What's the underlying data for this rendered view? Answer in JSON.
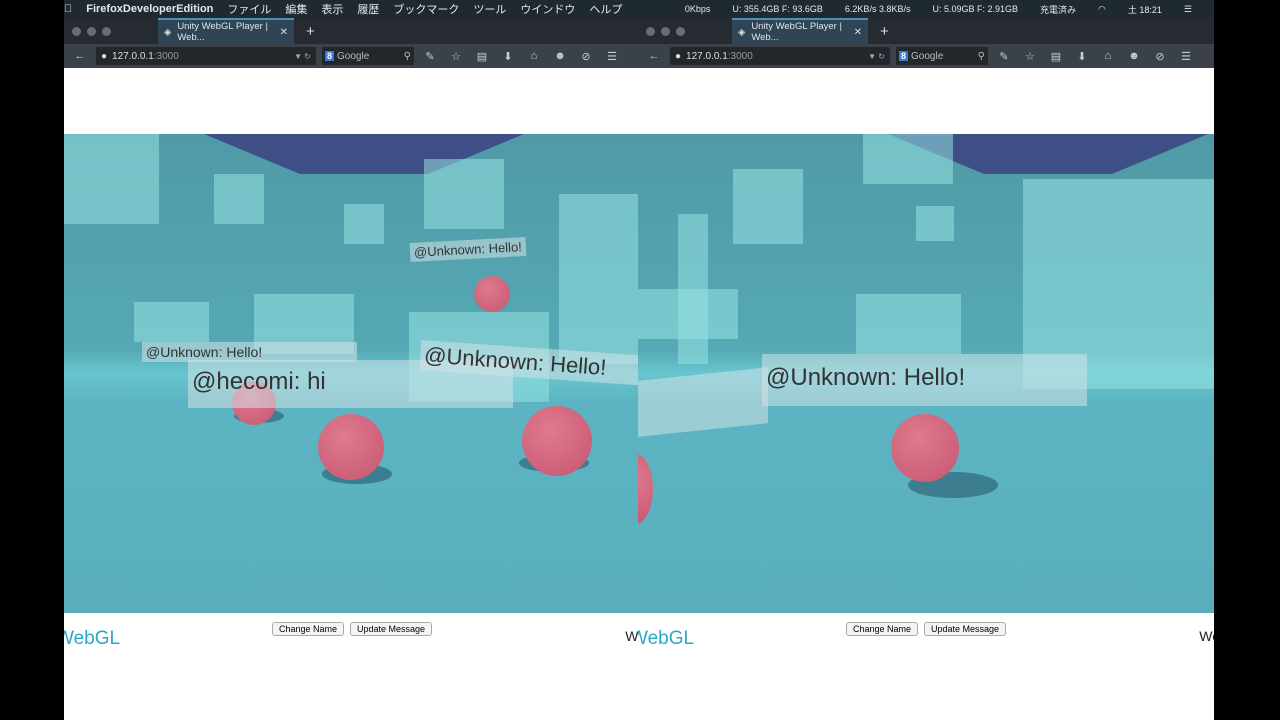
{
  "menubar": {
    "app": "FirefoxDeveloperEdition",
    "items": [
      "ファイル",
      "編集",
      "表示",
      "履歴",
      "ブックマーク",
      "ツール",
      "ウインドウ",
      "ヘルプ"
    ],
    "status": [
      "0Kbps",
      "U: 355.4GB F: 93.6GB",
      "6.2KB/s 3.8KB/s",
      "U: 5.09GB F: 2.91GB",
      "充電済み",
      "土 18:21"
    ]
  },
  "windows": [
    {
      "tab_title": "Unity WebGL Player | Web...",
      "url_host": "127.0.0.1",
      "url_port": ":3000",
      "search_placeholder": "Google",
      "labels": [
        "@Unknown: Hello!",
        "@Unknown: Hello!",
        "@hecomi: hi",
        "@Unknown: Hello!"
      ],
      "buttons": [
        "Change Name",
        "Update Message"
      ],
      "logo": "WebGL",
      "logo_right": "We"
    },
    {
      "tab_title": "Unity WebGL Player | Web...",
      "url_host": "127.0.0.1",
      "url_port": ":3000",
      "search_placeholder": "Google",
      "labels": [
        "@Unknown: Hello!"
      ],
      "buttons": [
        "Change Name",
        "Update Message"
      ],
      "logo": "WebGL",
      "logo_right": "We"
    }
  ]
}
